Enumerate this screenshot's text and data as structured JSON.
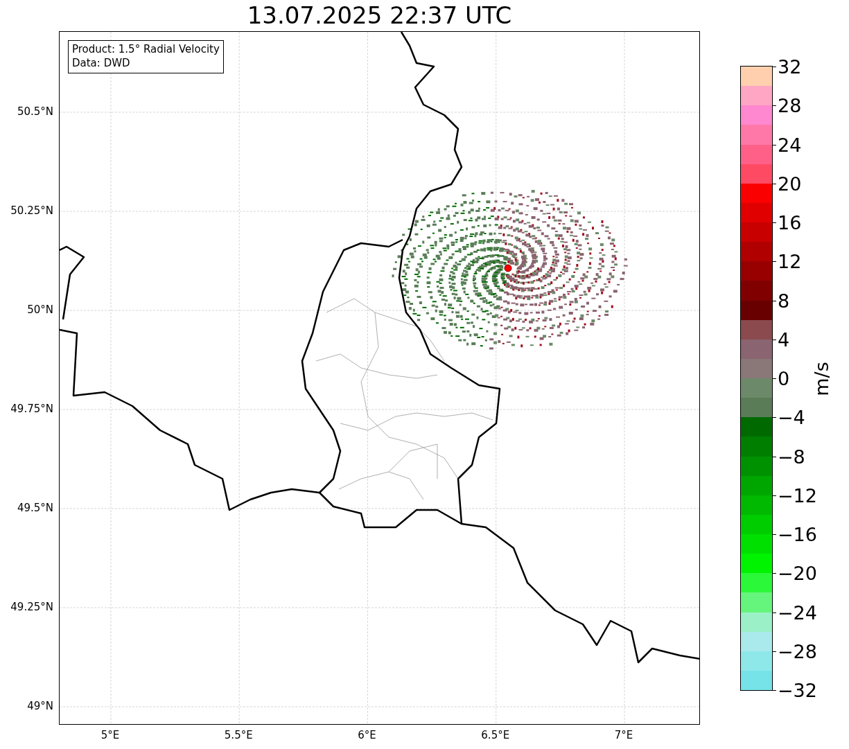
{
  "title": "13.07.2025 22:37 UTC",
  "legend": {
    "lines": [
      "Product: 1.5° Radial Velocity",
      "Data: DWD"
    ]
  },
  "y_ticks": [
    "50.5°N",
    "50.25°N",
    "50°N",
    "49.75°N",
    "49.5°N",
    "49.25°N",
    "49°N"
  ],
  "x_ticks": [
    "5°E",
    "5.5°E",
    "6°E",
    "6.5°E",
    "7°E"
  ],
  "colorbar": {
    "label": "m/s",
    "ticks": [
      "32",
      "28",
      "24",
      "20",
      "16",
      "12",
      "8",
      "4",
      "0",
      "−4",
      "−8",
      "−12",
      "−16",
      "−20",
      "−24",
      "−28",
      "−32"
    ],
    "bins": [
      {
        "color": "#ffcfae"
      },
      {
        "color": "#ffa6c4"
      },
      {
        "color": "#ff88d0"
      },
      {
        "color": "#ff78a8"
      },
      {
        "color": "#ff6088"
      },
      {
        "color": "#ff4a64"
      },
      {
        "color": "#fa0000"
      },
      {
        "color": "#e00000"
      },
      {
        "color": "#c80000"
      },
      {
        "color": "#b00000"
      },
      {
        "color": "#980000"
      },
      {
        "color": "#800000"
      },
      {
        "color": "#680000"
      },
      {
        "color": "#8a4a4e"
      },
      {
        "color": "#8a6470"
      },
      {
        "color": "#8a7878"
      },
      {
        "color": "#6c8a69"
      },
      {
        "color": "#5a7d58"
      },
      {
        "color": "#006a00"
      },
      {
        "color": "#007e00"
      },
      {
        "color": "#009100"
      },
      {
        "color": "#00a600"
      },
      {
        "color": "#00b900"
      },
      {
        "color": "#00cd00"
      },
      {
        "color": "#00e000"
      },
      {
        "color": "#00f400"
      },
      {
        "color": "#2cf83a"
      },
      {
        "color": "#66f57c"
      },
      {
        "color": "#9cf0c8"
      },
      {
        "color": "#aae9ec"
      },
      {
        "color": "#8ee8ea"
      },
      {
        "color": "#76e3e8"
      }
    ]
  }
}
